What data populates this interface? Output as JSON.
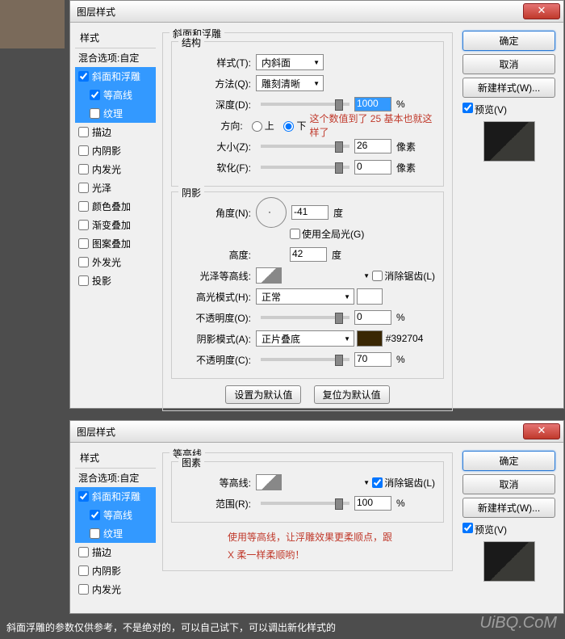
{
  "dialog1": {
    "title": "图层样式",
    "sidebar": {
      "header": "样式",
      "blend": "混合选项:自定",
      "items": [
        "斜面和浮雕",
        "等高线",
        "纹理",
        "描边",
        "内阴影",
        "内发光",
        "光泽",
        "颜色叠加",
        "渐变叠加",
        "图案叠加",
        "外发光",
        "投影"
      ]
    },
    "bevel": {
      "group_title": "斜面和浮雕",
      "struct_title": "结构",
      "style_label": "样式(T):",
      "style_value": "内斜面",
      "method_label": "方法(Q):",
      "method_value": "雕刻清晰",
      "depth_label": "深度(D):",
      "depth_value": "1000",
      "depth_unit": "%",
      "dir_label": "方向:",
      "dir_up": "上",
      "dir_down": "下",
      "dir_note": "这个数值到了 25 基本也就这样了",
      "size_label": "大小(Z):",
      "size_value": "26",
      "size_unit": "像素",
      "soften_label": "软化(F):",
      "soften_value": "0",
      "soften_unit": "像素",
      "shadow_title": "阴影",
      "angle_label": "角度(N):",
      "angle_value": "-41",
      "angle_unit": "度",
      "global_label": "使用全局光(G)",
      "alt_label": "高度:",
      "alt_value": "42",
      "alt_unit": "度",
      "gloss_label": "光泽等高线:",
      "aa_label": "消除锯齿(L)",
      "hilite_label": "高光模式(H):",
      "hilite_value": "正常",
      "hilite_op_label": "不透明度(O):",
      "hilite_op_value": "0",
      "hilite_op_unit": "%",
      "shadow_mode_label": "阴影模式(A):",
      "shadow_mode_value": "正片叠底",
      "shadow_color_note": "#392704",
      "shadow_op_label": "不透明度(C):",
      "shadow_op_value": "70",
      "shadow_op_unit": "%",
      "btn_default": "设置为默认值",
      "btn_reset": "复位为默认值"
    },
    "right": {
      "ok": "确定",
      "cancel": "取消",
      "newstyle": "新建样式(W)...",
      "preview": "预览(V)"
    }
  },
  "dialog2": {
    "title": "图层样式",
    "sidebar": {
      "header": "样式",
      "blend": "混合选项:自定",
      "items": [
        "斜面和浮雕",
        "等高线",
        "纹理",
        "描边",
        "内阴影",
        "内发光"
      ]
    },
    "contour": {
      "group_title": "等高线",
      "elem_title": "图素",
      "contour_label": "等高线:",
      "aa_label": "消除锯齿(L)",
      "range_label": "范围(R):",
      "range_value": "100",
      "range_unit": "%",
      "note_line1": "使用等高线，让浮雕效果更柔顺点，跟",
      "note_line2": "X 柔一样柔顺哟！"
    },
    "right": {
      "ok": "确定",
      "cancel": "取消",
      "newstyle": "新建样式(W)...",
      "preview": "预览(V)"
    }
  },
  "footer_text": "斜面浮雕的参数仅供参考，不是绝对的，可以自己试下，可以调出新化样式的",
  "watermark": "UiBQ.CoM"
}
